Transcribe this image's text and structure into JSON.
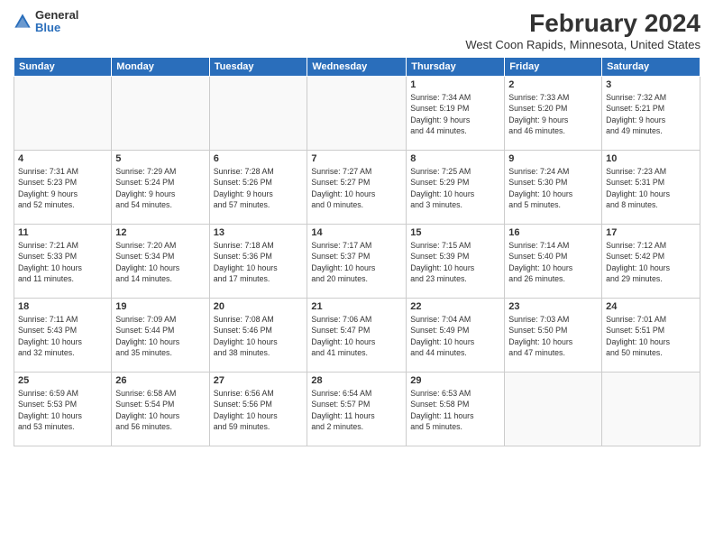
{
  "logo": {
    "general": "General",
    "blue": "Blue"
  },
  "header": {
    "month": "February 2024",
    "location": "West Coon Rapids, Minnesota, United States"
  },
  "days_of_week": [
    "Sunday",
    "Monday",
    "Tuesday",
    "Wednesday",
    "Thursday",
    "Friday",
    "Saturday"
  ],
  "weeks": [
    [
      {
        "day": "",
        "info": ""
      },
      {
        "day": "",
        "info": ""
      },
      {
        "day": "",
        "info": ""
      },
      {
        "day": "",
        "info": ""
      },
      {
        "day": "1",
        "info": "Sunrise: 7:34 AM\nSunset: 5:19 PM\nDaylight: 9 hours\nand 44 minutes."
      },
      {
        "day": "2",
        "info": "Sunrise: 7:33 AM\nSunset: 5:20 PM\nDaylight: 9 hours\nand 46 minutes."
      },
      {
        "day": "3",
        "info": "Sunrise: 7:32 AM\nSunset: 5:21 PM\nDaylight: 9 hours\nand 49 minutes."
      }
    ],
    [
      {
        "day": "4",
        "info": "Sunrise: 7:31 AM\nSunset: 5:23 PM\nDaylight: 9 hours\nand 52 minutes."
      },
      {
        "day": "5",
        "info": "Sunrise: 7:29 AM\nSunset: 5:24 PM\nDaylight: 9 hours\nand 54 minutes."
      },
      {
        "day": "6",
        "info": "Sunrise: 7:28 AM\nSunset: 5:26 PM\nDaylight: 9 hours\nand 57 minutes."
      },
      {
        "day": "7",
        "info": "Sunrise: 7:27 AM\nSunset: 5:27 PM\nDaylight: 10 hours\nand 0 minutes."
      },
      {
        "day": "8",
        "info": "Sunrise: 7:25 AM\nSunset: 5:29 PM\nDaylight: 10 hours\nand 3 minutes."
      },
      {
        "day": "9",
        "info": "Sunrise: 7:24 AM\nSunset: 5:30 PM\nDaylight: 10 hours\nand 5 minutes."
      },
      {
        "day": "10",
        "info": "Sunrise: 7:23 AM\nSunset: 5:31 PM\nDaylight: 10 hours\nand 8 minutes."
      }
    ],
    [
      {
        "day": "11",
        "info": "Sunrise: 7:21 AM\nSunset: 5:33 PM\nDaylight: 10 hours\nand 11 minutes."
      },
      {
        "day": "12",
        "info": "Sunrise: 7:20 AM\nSunset: 5:34 PM\nDaylight: 10 hours\nand 14 minutes."
      },
      {
        "day": "13",
        "info": "Sunrise: 7:18 AM\nSunset: 5:36 PM\nDaylight: 10 hours\nand 17 minutes."
      },
      {
        "day": "14",
        "info": "Sunrise: 7:17 AM\nSunset: 5:37 PM\nDaylight: 10 hours\nand 20 minutes."
      },
      {
        "day": "15",
        "info": "Sunrise: 7:15 AM\nSunset: 5:39 PM\nDaylight: 10 hours\nand 23 minutes."
      },
      {
        "day": "16",
        "info": "Sunrise: 7:14 AM\nSunset: 5:40 PM\nDaylight: 10 hours\nand 26 minutes."
      },
      {
        "day": "17",
        "info": "Sunrise: 7:12 AM\nSunset: 5:42 PM\nDaylight: 10 hours\nand 29 minutes."
      }
    ],
    [
      {
        "day": "18",
        "info": "Sunrise: 7:11 AM\nSunset: 5:43 PM\nDaylight: 10 hours\nand 32 minutes."
      },
      {
        "day": "19",
        "info": "Sunrise: 7:09 AM\nSunset: 5:44 PM\nDaylight: 10 hours\nand 35 minutes."
      },
      {
        "day": "20",
        "info": "Sunrise: 7:08 AM\nSunset: 5:46 PM\nDaylight: 10 hours\nand 38 minutes."
      },
      {
        "day": "21",
        "info": "Sunrise: 7:06 AM\nSunset: 5:47 PM\nDaylight: 10 hours\nand 41 minutes."
      },
      {
        "day": "22",
        "info": "Sunrise: 7:04 AM\nSunset: 5:49 PM\nDaylight: 10 hours\nand 44 minutes."
      },
      {
        "day": "23",
        "info": "Sunrise: 7:03 AM\nSunset: 5:50 PM\nDaylight: 10 hours\nand 47 minutes."
      },
      {
        "day": "24",
        "info": "Sunrise: 7:01 AM\nSunset: 5:51 PM\nDaylight: 10 hours\nand 50 minutes."
      }
    ],
    [
      {
        "day": "25",
        "info": "Sunrise: 6:59 AM\nSunset: 5:53 PM\nDaylight: 10 hours\nand 53 minutes."
      },
      {
        "day": "26",
        "info": "Sunrise: 6:58 AM\nSunset: 5:54 PM\nDaylight: 10 hours\nand 56 minutes."
      },
      {
        "day": "27",
        "info": "Sunrise: 6:56 AM\nSunset: 5:56 PM\nDaylight: 10 hours\nand 59 minutes."
      },
      {
        "day": "28",
        "info": "Sunrise: 6:54 AM\nSunset: 5:57 PM\nDaylight: 11 hours\nand 2 minutes."
      },
      {
        "day": "29",
        "info": "Sunrise: 6:53 AM\nSunset: 5:58 PM\nDaylight: 11 hours\nand 5 minutes."
      },
      {
        "day": "",
        "info": ""
      },
      {
        "day": "",
        "info": ""
      }
    ]
  ]
}
